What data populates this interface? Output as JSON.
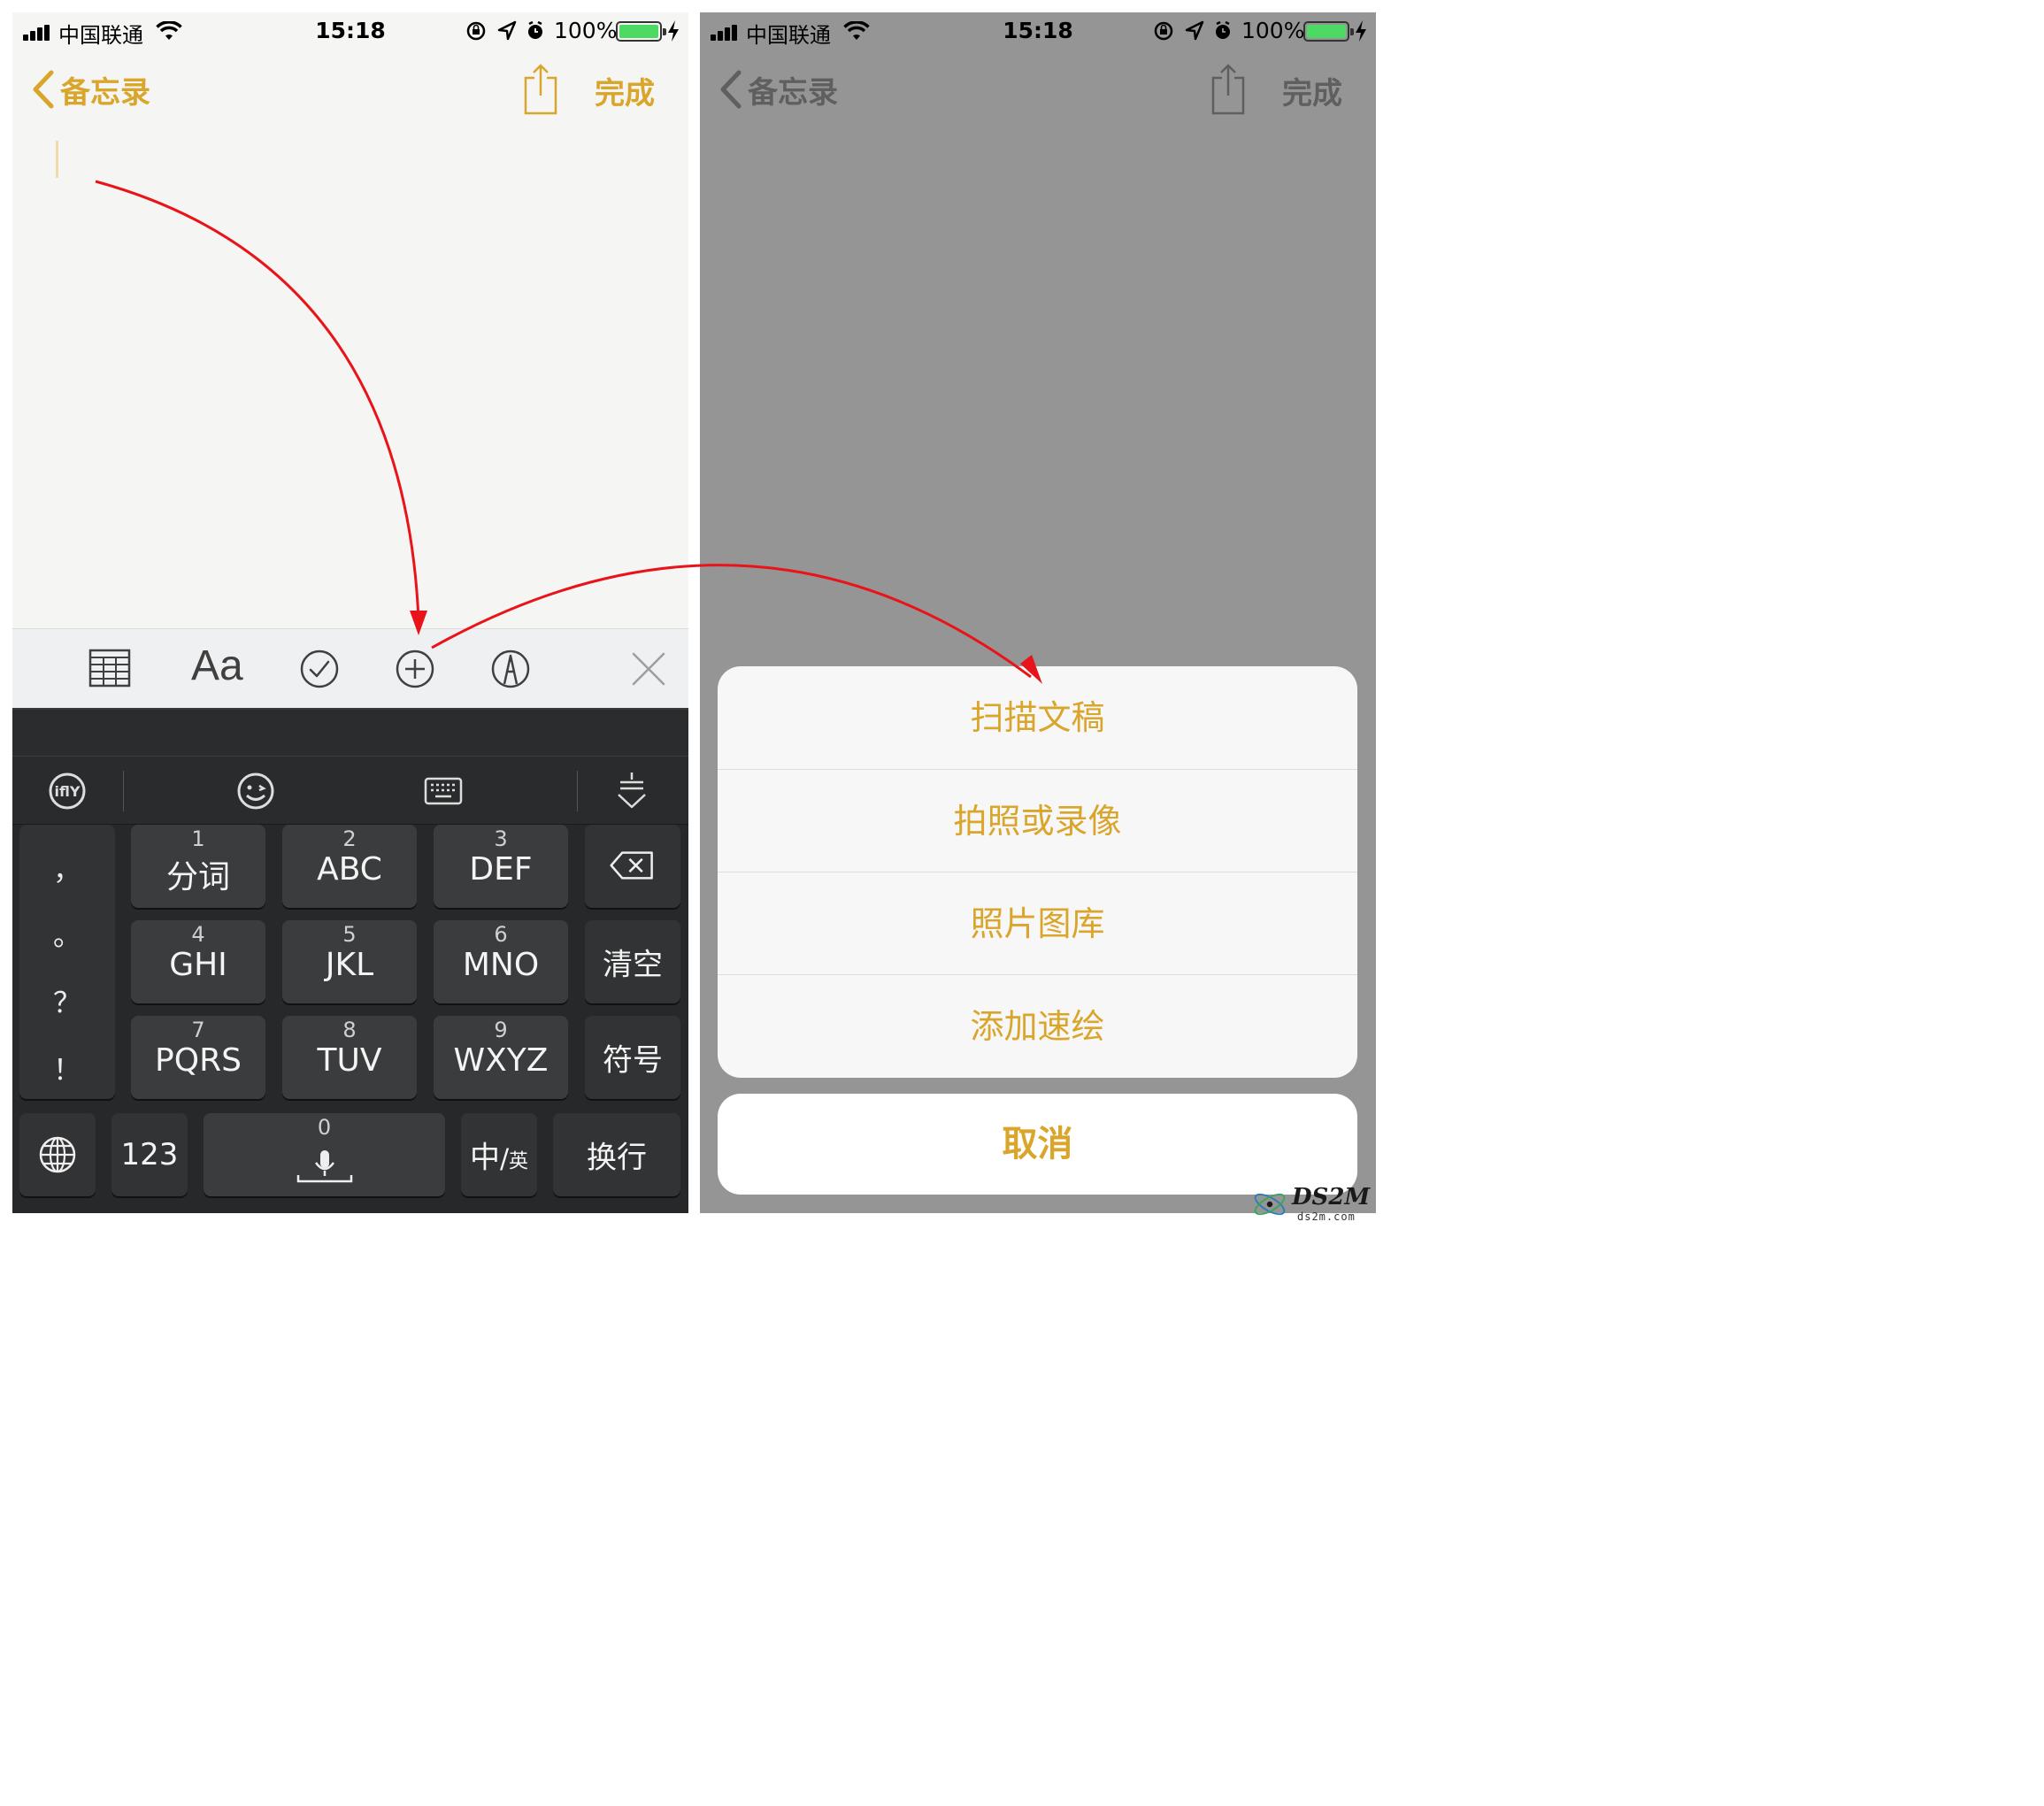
{
  "status_bar": {
    "carrier": "中国联通",
    "time": "15:18",
    "battery_percent": "100%",
    "battery_level": 1.0,
    "battery_color": "#4cd964"
  },
  "nav_bar": {
    "back_label": "备忘录",
    "done_label": "完成",
    "icons": [
      "chevron-left-icon",
      "share-icon"
    ]
  },
  "format_toolbar": {
    "text_style_label": "Aa",
    "icons": [
      "table-icon",
      "text-style-icon",
      "checklist-icon",
      "add-icon",
      "markup-icon",
      "close-icon"
    ]
  },
  "keyboard": {
    "top_icons": [
      "ifly-logo-icon",
      "emoji-icon",
      "keyboard-icon",
      "hide-keyboard-icon"
    ],
    "punctuation": [
      "，",
      "。",
      "？",
      "！"
    ],
    "keys": [
      {
        "num": "1",
        "label": "分词"
      },
      {
        "num": "2",
        "label": "ABC"
      },
      {
        "num": "3",
        "label": "DEF"
      },
      {
        "num": "4",
        "label": "GHI"
      },
      {
        "num": "5",
        "label": "JKL"
      },
      {
        "num": "6",
        "label": "MNO"
      },
      {
        "num": "7",
        "label": "PQRS"
      },
      {
        "num": "8",
        "label": "TUV"
      },
      {
        "num": "9",
        "label": "WXYZ"
      }
    ],
    "clear_label": "清空",
    "symbol_label": "符号",
    "numbers_label": "123",
    "space_num": "0",
    "lang_main": "中",
    "lang_sep": "/",
    "lang_sub": "英",
    "return_label": "换行"
  },
  "action_sheet": {
    "items": [
      "扫描文稿",
      "拍照或录像",
      "照片图库",
      "添加速绘"
    ],
    "cancel_label": "取消"
  },
  "watermark": {
    "title": "DS2M",
    "subtitle": "ds2m.com"
  },
  "colors": {
    "accent": "#d9a52b",
    "annotation_arrow": "#e8141a",
    "dimmed_background": "#959595"
  }
}
